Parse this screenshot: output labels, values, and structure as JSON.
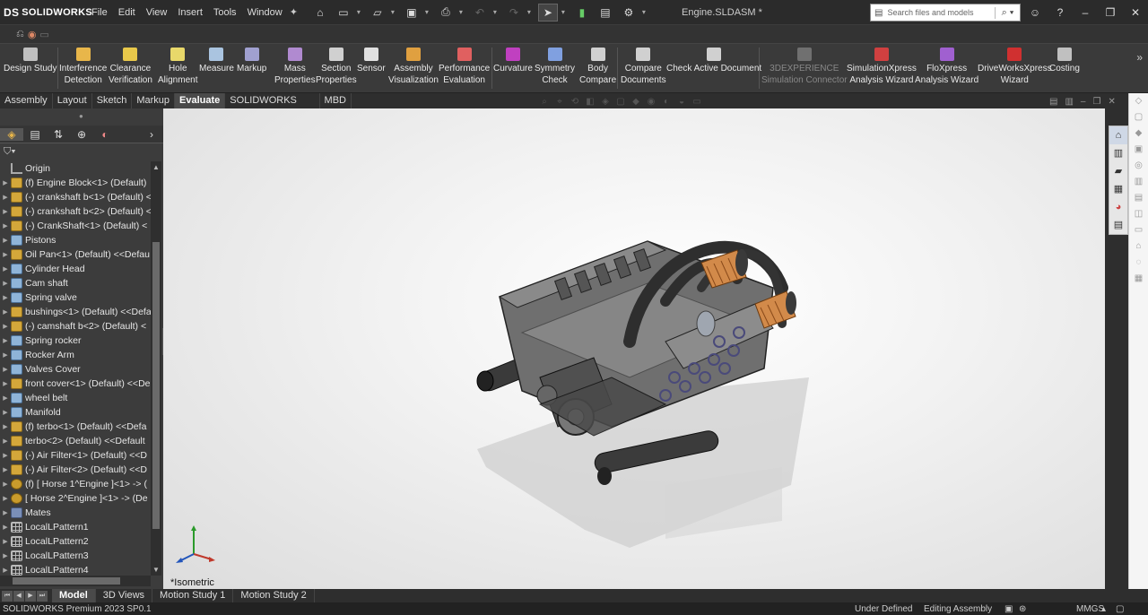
{
  "app": {
    "logo": "SOLIDWORKS",
    "logo_mark": "DS",
    "document_title": "Engine.SLDASM *"
  },
  "menu": [
    "File",
    "Edit",
    "View",
    "Insert",
    "Tools",
    "Window"
  ],
  "search": {
    "placeholder": "Search files and models"
  },
  "ribbon": [
    {
      "label": "Design Study",
      "color": "#c0c0c0"
    },
    {
      "label": "Interference\nDetection",
      "color": "#e8b64a"
    },
    {
      "label": "Clearance\nVerification",
      "color": "#e8c84a"
    },
    {
      "label": "Hole\nAlignment",
      "color": "#e8d86a"
    },
    {
      "label": "Measure",
      "color": "#aac4e0"
    },
    {
      "label": "Markup",
      "color": "#a0a0d0"
    },
    {
      "label": "Mass\nProperties",
      "color": "#b08ad0"
    },
    {
      "label": "Section\nProperties",
      "color": "#d0d0d0"
    },
    {
      "label": "Sensor",
      "color": "#e0e0e0"
    },
    {
      "label": "Assembly\nVisualization",
      "color": "#e0a040"
    },
    {
      "label": "Performance\nEvaluation",
      "color": "#e06060"
    },
    {
      "label": "Curvature",
      "color": "#c040c0"
    },
    {
      "label": "Symmetry\nCheck",
      "color": "#80a0e0"
    },
    {
      "label": "Body\nCompare",
      "color": "#d0d0d0"
    },
    {
      "label": "Compare\nDocuments",
      "color": "#d0d0d0"
    },
    {
      "label": "Check Active Document",
      "color": "#d0d0d0"
    },
    {
      "label": "3DEXPERIENCE\nSimulation Connector",
      "color": "#707070",
      "dim": true
    },
    {
      "label": "SimulationXpress\nAnalysis Wizard",
      "color": "#d04040"
    },
    {
      "label": "FloXpress\nAnalysis Wizard",
      "color": "#a060d0"
    },
    {
      "label": "DriveWorksXpress\nWizard",
      "color": "#d03030"
    },
    {
      "label": "Costing",
      "color": "#c0c0c0"
    }
  ],
  "tabs": [
    "Assembly",
    "Layout",
    "Sketch",
    "Markup",
    "Evaluate",
    "SOLIDWORKS Add-Ins",
    "MBD"
  ],
  "active_tab": "Evaluate",
  "tree": [
    {
      "label": "Origin",
      "icon": "origin",
      "expandable": false
    },
    {
      "label": "(f) Engine Block<1> (Default)",
      "icon": "part",
      "expandable": true
    },
    {
      "label": "(-) crankshaft b<1> (Default) <",
      "icon": "part",
      "expandable": true
    },
    {
      "label": "(-) crankshaft b<2> (Default) <",
      "icon": "part",
      "expandable": true
    },
    {
      "label": "(-) CrankShaft<1> (Default) <",
      "icon": "part",
      "expandable": true
    },
    {
      "label": "Pistons",
      "icon": "folder",
      "expandable": true
    },
    {
      "label": "Oil Pan<1> (Default) <<Defau",
      "icon": "part",
      "expandable": true
    },
    {
      "label": "Cylinder Head",
      "icon": "folder",
      "expandable": true
    },
    {
      "label": "Cam shaft",
      "icon": "folder",
      "expandable": true
    },
    {
      "label": "Spring valve",
      "icon": "folder",
      "expandable": true
    },
    {
      "label": "bushings<1> (Default) <<Defa",
      "icon": "part",
      "expandable": true
    },
    {
      "label": "(-) camshaft b<2> (Default) <",
      "icon": "part",
      "expandable": true
    },
    {
      "label": "Spring rocker",
      "icon": "folder",
      "expandable": true
    },
    {
      "label": "Rocker Arm",
      "icon": "folder",
      "expandable": true
    },
    {
      "label": "Valves Cover",
      "icon": "folder",
      "expandable": true
    },
    {
      "label": "front cover<1> (Default) <<De",
      "icon": "part",
      "expandable": true
    },
    {
      "label": "wheel belt",
      "icon": "folder",
      "expandable": true
    },
    {
      "label": "Manifold",
      "icon": "folder",
      "expandable": true
    },
    {
      "label": "(f) terbo<1> (Default) <<Defa",
      "icon": "part",
      "expandable": true
    },
    {
      "label": "terbo<2> (Default) <<Default",
      "icon": "part",
      "expandable": true
    },
    {
      "label": "(-) Air Filter<1> (Default) <<D",
      "icon": "part",
      "expandable": true
    },
    {
      "label": "(-) Air Filter<2> (Default) <<D",
      "icon": "part",
      "expandable": true
    },
    {
      "label": "(f) [ Horse 1^Engine ]<1> -> (",
      "icon": "sub",
      "expandable": true
    },
    {
      "label": "[ Horse 2^Engine ]<1> -> (De",
      "icon": "sub",
      "expandable": true
    },
    {
      "label": "Mates",
      "icon": "mates",
      "expandable": true
    },
    {
      "label": "LocalLPattern1",
      "icon": "pat",
      "expandable": true
    },
    {
      "label": "LocalLPattern2",
      "icon": "pat",
      "expandable": true
    },
    {
      "label": "LocalLPattern3",
      "icon": "pat",
      "expandable": true
    },
    {
      "label": "LocalLPattern4",
      "icon": "pat",
      "expandable": true
    }
  ],
  "viewport": {
    "view_label": "*Isometric"
  },
  "bottom_tabs": [
    "Model",
    "3D Views",
    "Motion Study 1",
    "Motion Study 2"
  ],
  "active_bottom_tab": "Model",
  "status": {
    "product": "SOLIDWORKS Premium 2023 SP0.1",
    "state": "Under Defined",
    "mode": "Editing Assembly",
    "units": "MMGS"
  }
}
